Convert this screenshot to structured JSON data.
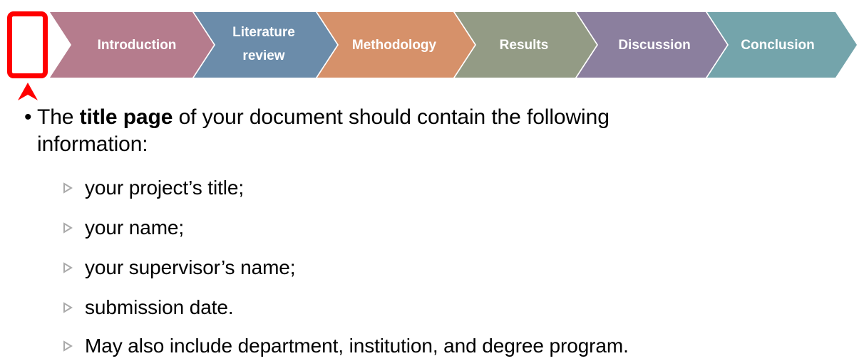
{
  "slide": {
    "type": "presentation-slide",
    "background_color": "#FFFFFF"
  },
  "process_banner": {
    "name": "research-sections-chevron-banner",
    "steps": [
      {
        "label": "Introduction",
        "color": "#B57C8D",
        "lines": [
          "Introduction"
        ]
      },
      {
        "label": "Literature review",
        "color": "#6B8CAA",
        "lines": [
          "Literature",
          "review"
        ]
      },
      {
        "label": "Methodology",
        "color": "#D6916A",
        "lines": [
          "Methodology"
        ]
      },
      {
        "label": "Results",
        "color": "#939B85",
        "lines": [
          "Results"
        ]
      },
      {
        "label": "Discussion",
        "color": "#8B7F9E",
        "lines": [
          "Discussion"
        ]
      },
      {
        "label": "Conclusion",
        "color": "#74A4AB",
        "lines": [
          "Conclusion"
        ]
      }
    ],
    "label_color": "#FFFFFF"
  },
  "annotation": {
    "highlight_color": "#FF0000",
    "shape": "rounded-rectangle",
    "arrow": "up-caret",
    "target": "Introduction"
  },
  "content": {
    "main_bullet": {
      "marker": "•",
      "prefix": "The ",
      "bold": "title page",
      "suffix": " of your document should contain the following",
      "line2": "information:"
    },
    "sub_marker": "▹",
    "sub_bullets": [
      "your project’s title;",
      "your name;",
      "your supervisor’s name;",
      "submission date.",
      "May also include department, institution, and degree program."
    ]
  }
}
